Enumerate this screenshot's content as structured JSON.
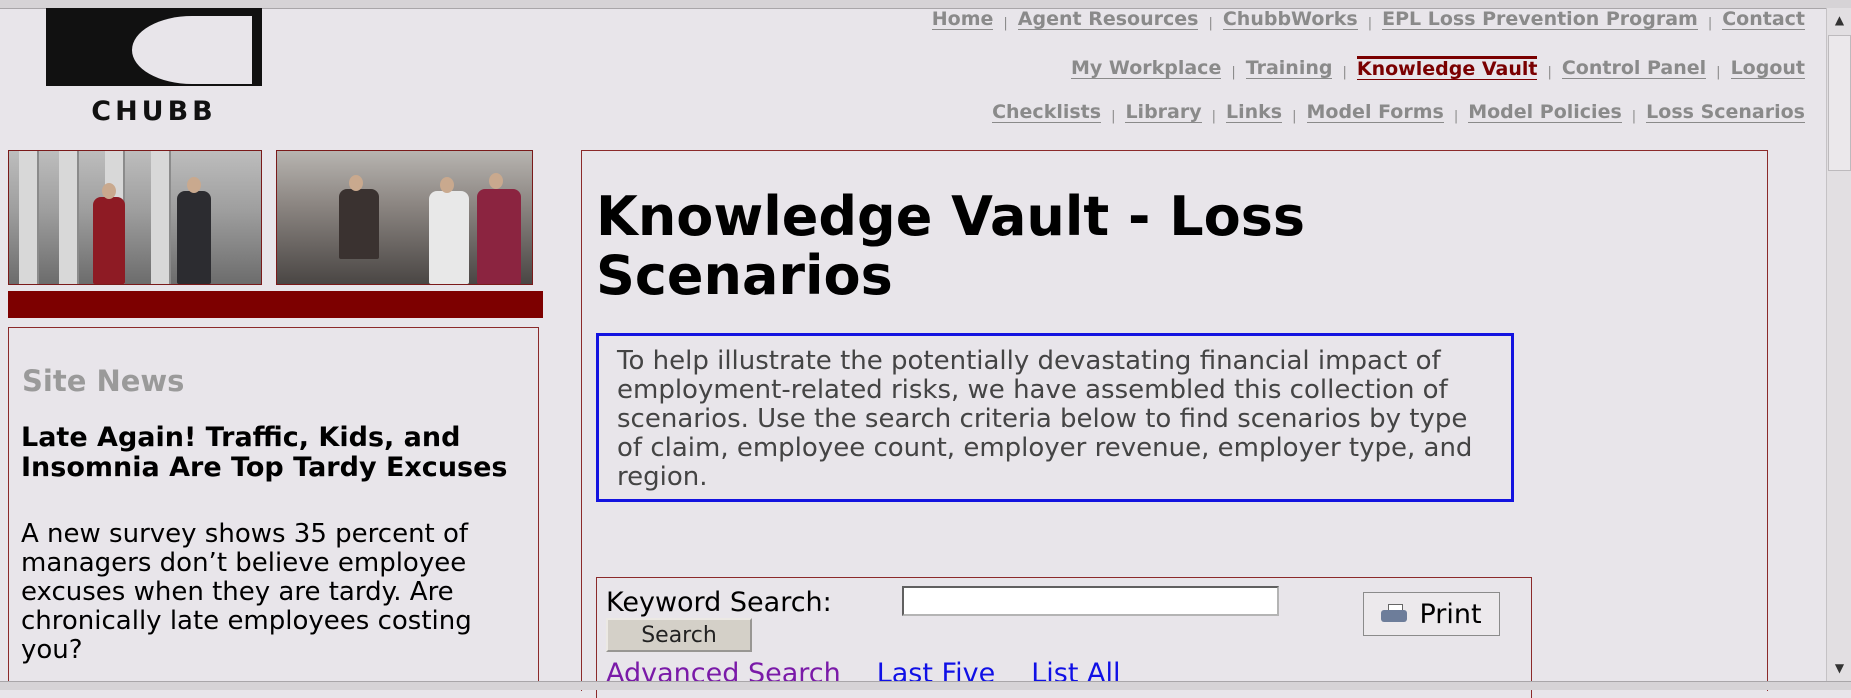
{
  "brand": {
    "logo_text": "CHUBB"
  },
  "nav": {
    "row1": [
      "Home",
      "Agent Resources",
      "ChubbWorks",
      "EPL Loss Prevention Program",
      "Contact"
    ],
    "row2": [
      "My Workplace",
      "Training",
      "Knowledge Vault",
      "Control Panel",
      "Logout"
    ],
    "row3": [
      "Checklists",
      "Library",
      "Links",
      "Model Forms",
      "Model Policies",
      "Loss Scenarios"
    ],
    "active": "Knowledge Vault"
  },
  "news": {
    "heading": "Site News",
    "article_title": "Late Again! Traffic, Kids, and Insomnia Are Top Tardy Excuses",
    "article_text": "A new survey shows 35 percent of managers don’t believe employee excuses when they are tardy. Are chronically late employees costing you?"
  },
  "main": {
    "title": "Knowledge Vault - Loss Scenarios",
    "intro": "To help illustrate the potentially devastating financial impact of employment-related risks, we have assembled this collection of scenarios. Use the search criteria below to find scenarios by type of claim, employee count, employer revenue, employer type, and region."
  },
  "search": {
    "keyword_label": "Keyword Search:",
    "keyword_value": "",
    "search_button": "Search",
    "print_button": "Print",
    "links": {
      "advanced": "Advanced Search",
      "last_five": "Last Five",
      "list_all": "List All"
    }
  },
  "colors": {
    "accent": "#7d0000",
    "link": "#1010e6",
    "visited": "#7a1aa8",
    "intro_border": "#1313e0"
  },
  "icons": [
    "printer-icon",
    "scroll-up-arrow-icon",
    "scroll-down-arrow-icon"
  ]
}
